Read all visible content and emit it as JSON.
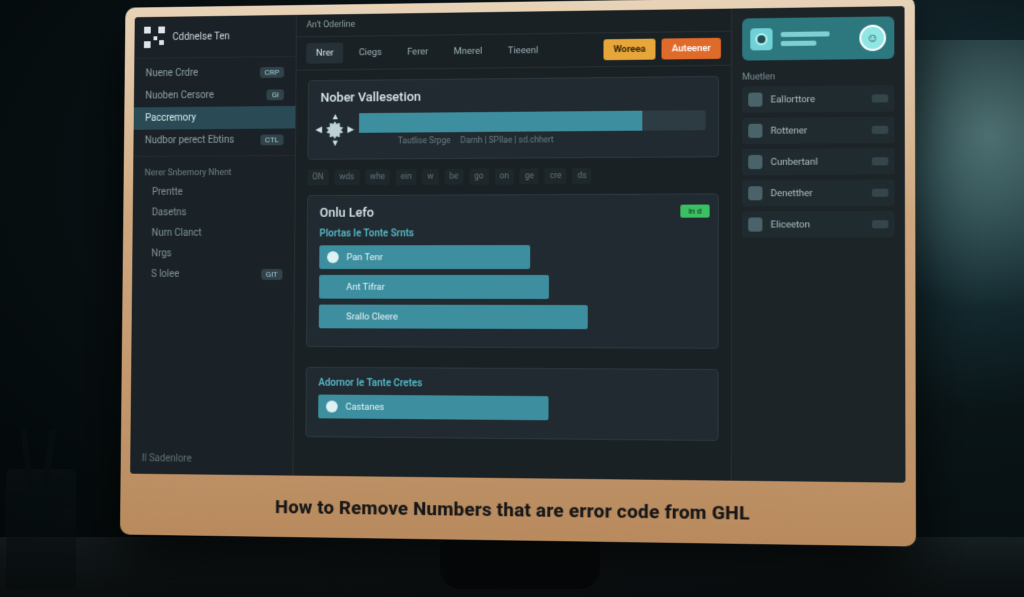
{
  "caption": "How to Remove Numbers that are error code from GHL",
  "sidebar": {
    "brand": "Cddnelse Ten",
    "group1": [
      {
        "label": "Nuene Crdre",
        "badge": "CRP"
      },
      {
        "label": "Nuoben Cersore",
        "badge": "GI"
      },
      {
        "label": "Paccremory",
        "badge": ""
      },
      {
        "label": "Nudbor perect Ebtins",
        "badge": "CTL"
      }
    ],
    "group2_head": "Nerer Snbemory Nhent",
    "group2": [
      {
        "label": "Prentte"
      },
      {
        "label": "Dasetns"
      },
      {
        "label": "Nurn Clanct"
      },
      {
        "label": "Nrgs"
      },
      {
        "label": "S lolee",
        "badge": "GIT"
      }
    ],
    "footer": "Il Sadenlore"
  },
  "header": {
    "crumb": "An't Oderline",
    "tabs": [
      "Nrer",
      "Ciegs",
      "Ferer",
      "Mnerel",
      "Tieeenl"
    ],
    "selected": 0,
    "btn_primary": "Woreea",
    "btn_secondary": "Auteener"
  },
  "panel_validate": {
    "title": "Nober Vallesetion",
    "meta": [
      "Tautlise Srpge",
      "Darnh | SPIlae | sd.chhert"
    ]
  },
  "mini_tabs": [
    "ON",
    "wds",
    "whe",
    "ein",
    "w",
    "be",
    "go",
    "on",
    "ge",
    "cre",
    "ds"
  ],
  "panel_onlu": {
    "title": "Onlu Lefo",
    "subtitle": "Plortas Ie Tonte Srnts",
    "ok_chip": "In d",
    "rows": [
      {
        "icon": "dot",
        "label": "Pan Tenr"
      },
      {
        "icon": "gear",
        "label": "Ant Tifrar"
      },
      {
        "icon": "gear",
        "label": "Srallo Cleere"
      }
    ]
  },
  "panel_adornor": {
    "title": "Adornor Ie Tante Cretes",
    "rows": [
      {
        "icon": "dot",
        "label": "Castanes"
      }
    ]
  },
  "rightcol": {
    "head": "Muetlen",
    "items": [
      {
        "label": "Eallorttore"
      },
      {
        "label": "Rottener"
      },
      {
        "label": "Cunbertanl"
      },
      {
        "label": "Denetther"
      },
      {
        "label": "Eliceeton"
      }
    ]
  }
}
